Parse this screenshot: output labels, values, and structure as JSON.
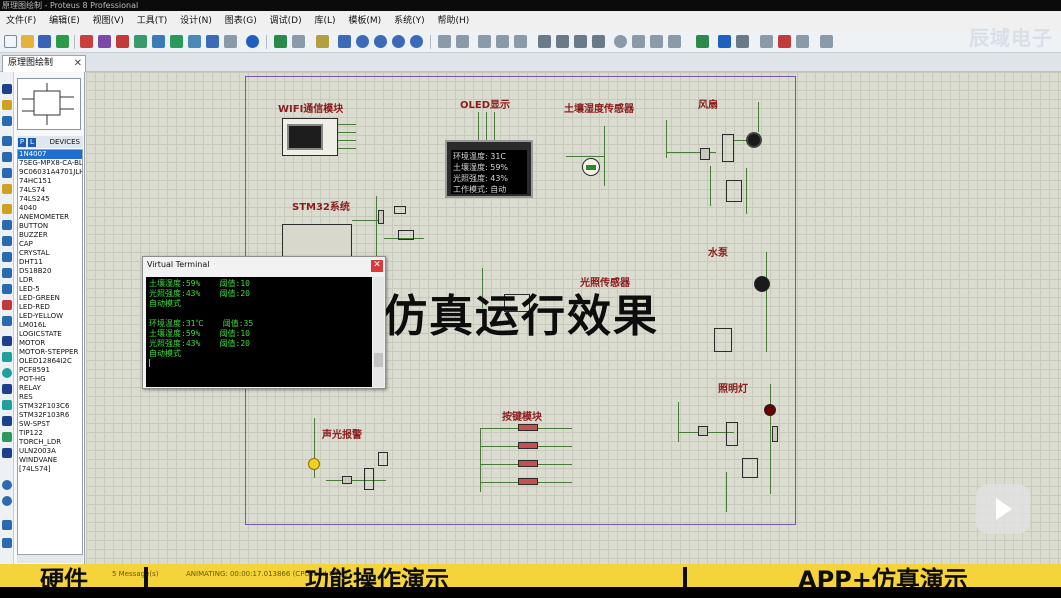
{
  "window": {
    "title": "原理图绘制 - Proteus 8 Professional"
  },
  "menu": [
    "文件(F)",
    "编辑(E)",
    "视图(V)",
    "工具(T)",
    "设计(N)",
    "图表(G)",
    "调试(D)",
    "库(L)",
    "模板(M)",
    "系统(Y)",
    "帮助(H)"
  ],
  "watermark": "辰域电子",
  "tab": {
    "label": "原理图绘制",
    "close": "✕"
  },
  "devices": {
    "p_label": "P",
    "l_label": "L",
    "header": "DEVICES",
    "selected": "1N4007",
    "items": [
      "1N4007",
      "7SEG-MPX8-CA-BL",
      "9C06031A4701JLH",
      "74HC151",
      "74LS74",
      "74LS245",
      "4040",
      "ANEMOMETER",
      "BUTTON",
      "BUZZER",
      "CAP",
      "CRYSTAL",
      "DHT11",
      "DS18B20",
      "LDR",
      "LED-5",
      "LED-GREEN",
      "LED-RED",
      "LED-YELLOW",
      "LM016L",
      "LOGICSTATE",
      "MOTOR",
      "MOTOR-STEPPER",
      "OLED12864I2C",
      "PCF8591",
      "POT-HG",
      "RELAY",
      "RES",
      "STM32F103C6",
      "STM32F103R6",
      "SW-SPST",
      "TIP122",
      "TORCH_LDR",
      "ULN2003A",
      "WINDVANE",
      "[74LS74]"
    ]
  },
  "schematic": {
    "labels": [
      "WIFI通信模块",
      "OLED显示",
      "土壤湿度传感器",
      "风扇",
      "STM32系统",
      "水泵",
      "光照传感器",
      "声光报警",
      "按键模块",
      "照明灯"
    ],
    "oled_lines": [
      "环境温度: 31C",
      "土壤湿度: 59%",
      "光照强度: 43%",
      "工作模式: 自动"
    ]
  },
  "terminal": {
    "title": "Virtual Terminal",
    "close": "✕",
    "lines": [
      "土壤湿度:59%    阈值:10",
      "光照强度:43%    阈值:20",
      "自动模式",
      "",
      "环境温度:31℃    阈值:35",
      "土壤湿度:59%    阈值:10",
      "光照强度:43%    阈值:20",
      "自动模式"
    ]
  },
  "overlay_caption": "仿真运行效果",
  "status": {
    "messages": "5 Message(s)",
    "animating": "ANIMATING: 00:00:17.013866 (CPU load 84%)"
  },
  "nav": {
    "hardware": "硬件",
    "function": "功能操作演示",
    "app": "APP+仿真演示"
  },
  "colors": {
    "status_bar": "#f5d33a",
    "selected_device": "#1f6dd0",
    "terminal_text": "#3ede3e",
    "module_label": "#8b1c1c"
  }
}
